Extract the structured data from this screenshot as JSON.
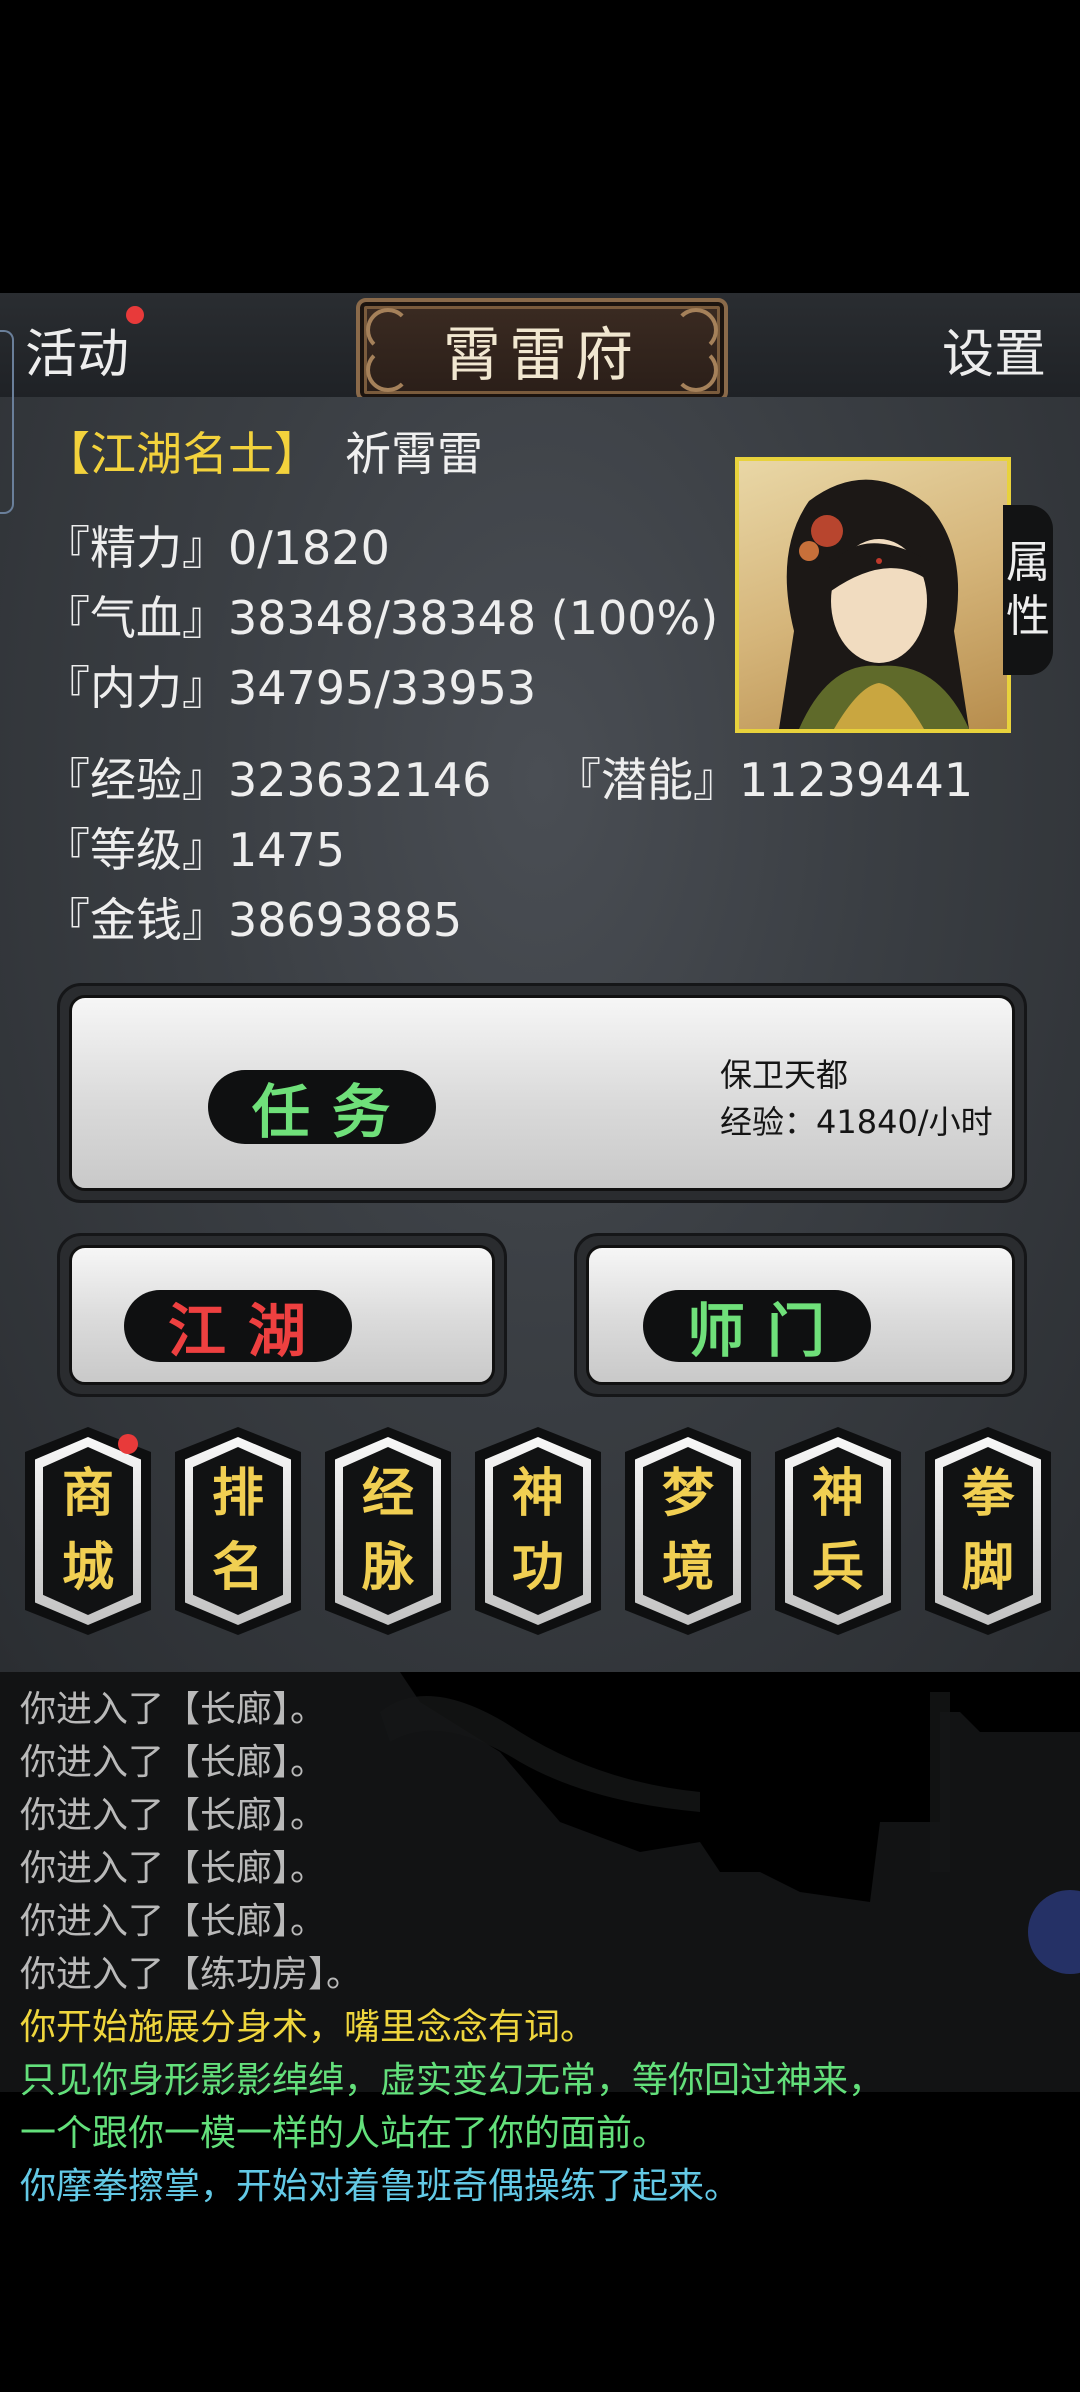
{
  "header": {
    "activity_label": "活动",
    "title": "霄雷府",
    "settings_label": "设置"
  },
  "profile": {
    "title_badge": "【江湖名士】",
    "name": "祈霄雷",
    "stats": {
      "stamina": "『精力』0/1820",
      "hp": "『气血』38348/38348 (100%)",
      "mp": "『内力』34795/33953",
      "exp": "『经验』323632146",
      "potential": "『潜能』11239441",
      "level": "『等级』1475",
      "money": "『金钱』38693885"
    },
    "attribute_tab": [
      "属",
      "性"
    ]
  },
  "actions": {
    "quest_label": "任务",
    "quest_name": "保卫天都",
    "quest_exp": "经验：41840/小时",
    "jianghu_label": "江湖",
    "shimen_label": "师门"
  },
  "menu": [
    {
      "top": "商",
      "bottom": "城"
    },
    {
      "top": "排",
      "bottom": "名"
    },
    {
      "top": "经",
      "bottom": "脉"
    },
    {
      "top": "神",
      "bottom": "功"
    },
    {
      "top": "梦",
      "bottom": "境"
    },
    {
      "top": "神",
      "bottom": "兵"
    },
    {
      "top": "拳",
      "bottom": "脚"
    }
  ],
  "log": [
    {
      "text": "你进入了【长廊】。",
      "color": "gray"
    },
    {
      "text": "你进入了【长廊】。",
      "color": "gray"
    },
    {
      "text": "你进入了【长廊】。",
      "color": "gray"
    },
    {
      "text": "你进入了【长廊】。",
      "color": "gray"
    },
    {
      "text": "你进入了【长廊】。",
      "color": "gray"
    },
    {
      "text": "你进入了【练功房】。",
      "color": "gray"
    },
    {
      "text": "你开始施展分身术，嘴里念念有词。",
      "color": "yellow"
    },
    {
      "text": "只见你身形影影绰绰，虚实变幻无常，等你回过神来，",
      "color": "green"
    },
    {
      "text": "一个跟你一模一样的人站在了你的面前。",
      "color": "green"
    },
    {
      "text": "你摩拳擦掌，开始对着鲁班奇偶操练了起来。",
      "color": "cyan"
    }
  ],
  "colors": {
    "badge_yellow": "#f3d23c",
    "green_text": "#6fe07a",
    "red_text": "#ee4040",
    "notification_red": "#e83a3a"
  }
}
